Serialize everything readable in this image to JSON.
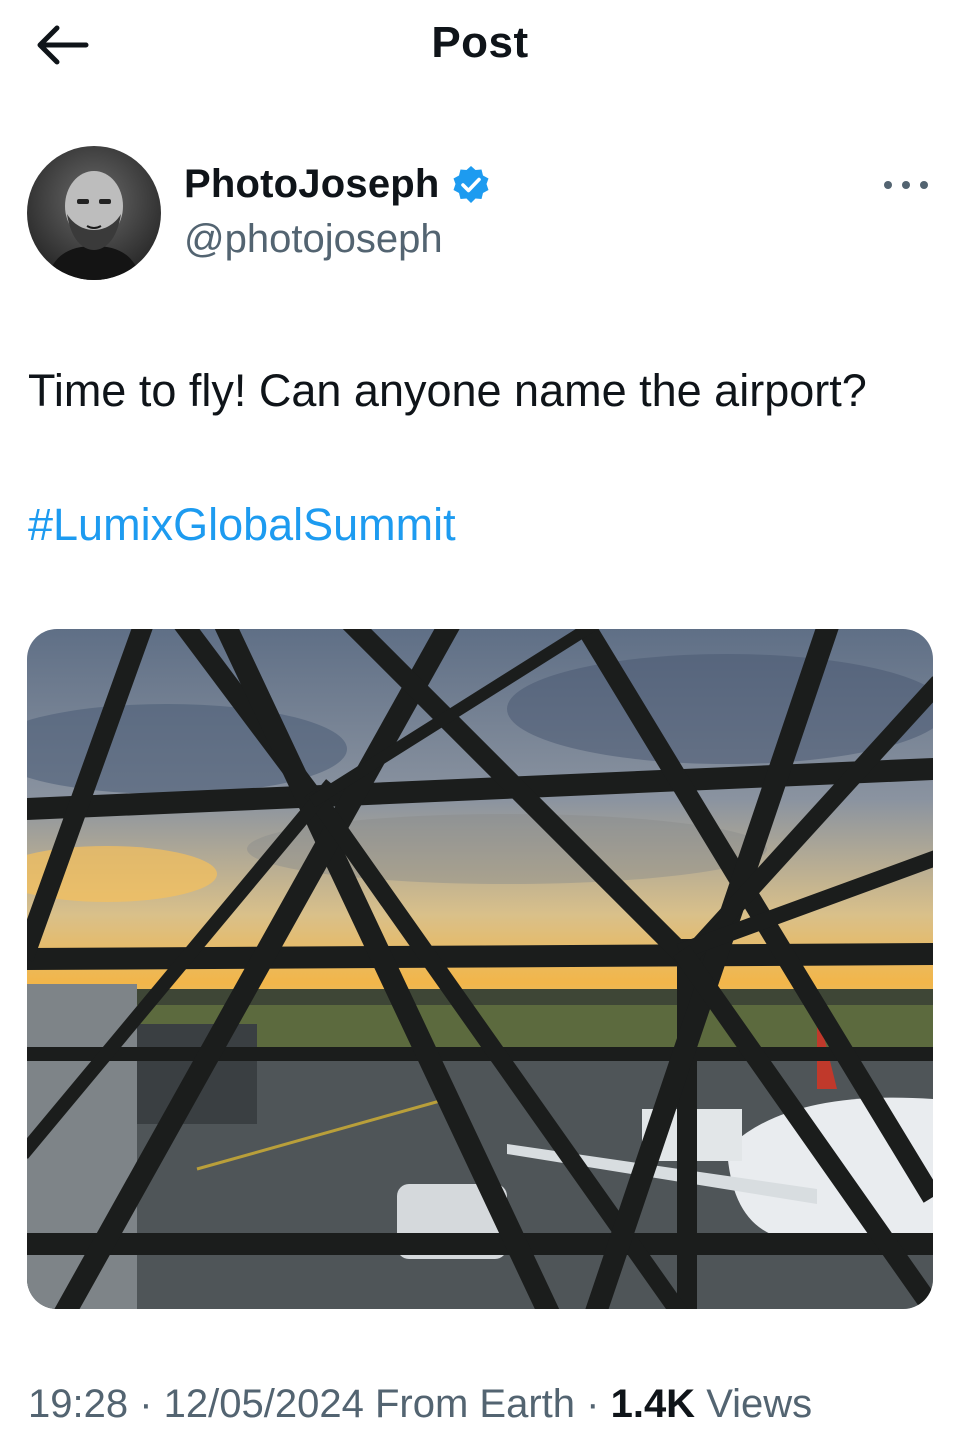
{
  "header": {
    "title": "Post",
    "back_icon": "arrow-left-icon"
  },
  "author": {
    "display_name": "PhotoJoseph",
    "handle": "@photojoseph",
    "verified_color": "#1d9bf0"
  },
  "post": {
    "text": "Time to fly! Can anyone name the airport?",
    "hashtag": "#LumixGlobalSummit",
    "hashtag_color": "#1d9bf0",
    "image_alt": ""
  },
  "meta": {
    "time": "19:28",
    "date": "12/05/2024",
    "source": "From Earth",
    "views_count": "1.4K",
    "views_label": "Views"
  }
}
